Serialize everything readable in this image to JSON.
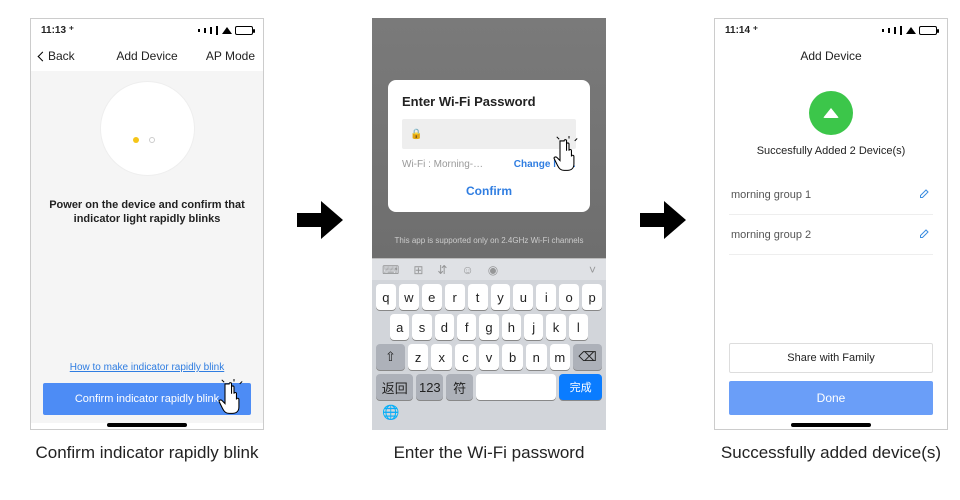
{
  "status": {
    "time1": "11:13 ⁺",
    "time3": "11:14 ⁺"
  },
  "step1": {
    "back": "Back",
    "title": "Add Device",
    "right": "AP Mode",
    "instruction": "Power on the device and confirm that indicator light rapidly blinks",
    "help_link": "How to make indicator rapidly blink",
    "button": "Confirm indicator rapidly blink",
    "caption": "Confirm indicator rapidly blink"
  },
  "step2": {
    "modal_title": "Enter Wi-Fi Password",
    "wifi_label": "Wi-Fi : Morning-…",
    "change": "Change Ne…",
    "confirm": "Confirm",
    "note": "This app is supported only on 2.4GHz Wi-Fi channels",
    "keys_row1": [
      "q",
      "w",
      "e",
      "r",
      "t",
      "y",
      "u",
      "i",
      "o",
      "p"
    ],
    "keys_row2": [
      "a",
      "s",
      "d",
      "f",
      "g",
      "h",
      "j",
      "k",
      "l"
    ],
    "keys_row3": [
      "⇧",
      "z",
      "x",
      "c",
      "v",
      "b",
      "n",
      "m",
      "⌫"
    ],
    "keys_row4": [
      "返回",
      "123",
      "符",
      "",
      "完成"
    ],
    "caption": "Enter the Wi-Fi password"
  },
  "step3": {
    "title": "Add Device",
    "success": "Succesfully Added 2 Device(s)",
    "devices": [
      "morning group 1",
      "morning group 2"
    ],
    "share": "Share with Family",
    "done": "Done",
    "caption": "Successfully added device(s)"
  }
}
